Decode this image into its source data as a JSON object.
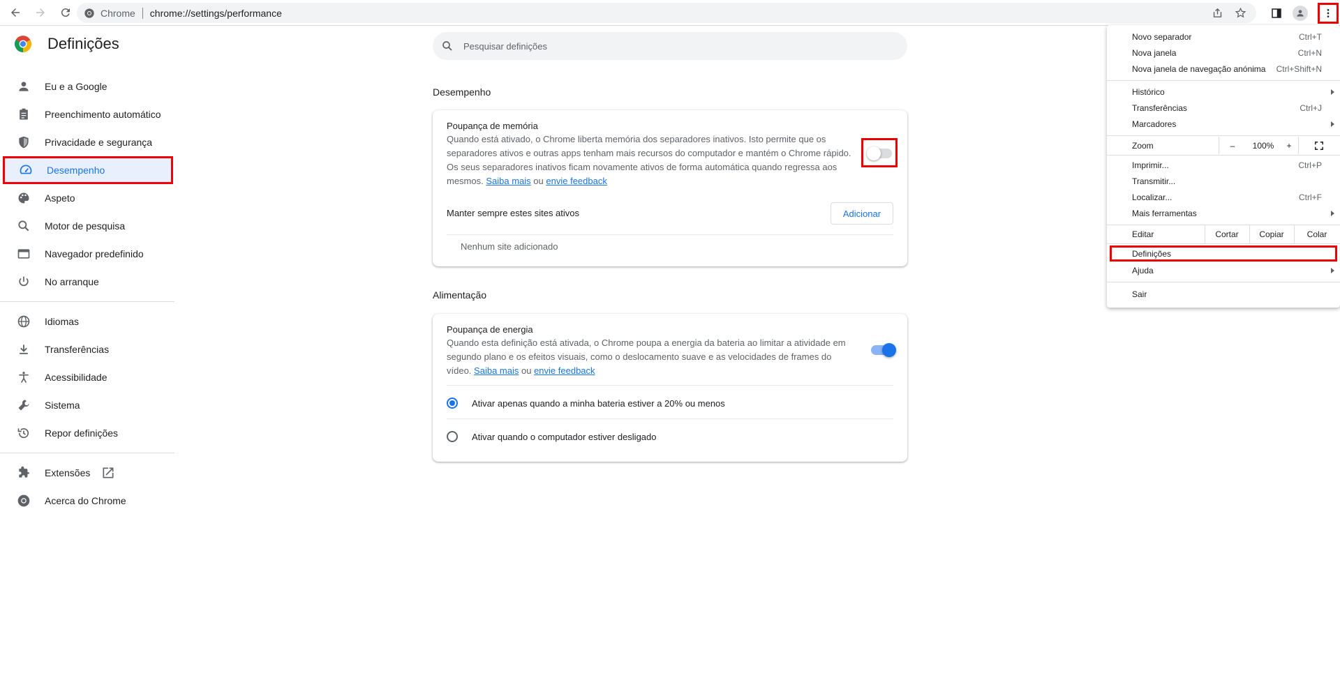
{
  "omnibox": {
    "site_label": "Chrome",
    "url": "chrome://settings/performance"
  },
  "sidebar": {
    "title": "Definições",
    "items": [
      {
        "label": "Eu e a Google",
        "icon": "person-icon"
      },
      {
        "label": "Preenchimento automático",
        "icon": "clipboard-icon"
      },
      {
        "label": "Privacidade e segurança",
        "icon": "shield-icon"
      },
      {
        "label": "Desempenho",
        "icon": "speedometer-icon"
      },
      {
        "label": "Aspeto",
        "icon": "palette-icon"
      },
      {
        "label": "Motor de pesquisa",
        "icon": "search-icon"
      },
      {
        "label": "Navegador predefinido",
        "icon": "browser-icon"
      },
      {
        "label": "No arranque",
        "icon": "power-icon"
      },
      {
        "label": "Idiomas",
        "icon": "globe-icon"
      },
      {
        "label": "Transferências",
        "icon": "download-icon"
      },
      {
        "label": "Acessibilidade",
        "icon": "accessibility-icon"
      },
      {
        "label": "Sistema",
        "icon": "wrench-icon"
      },
      {
        "label": "Repor definições",
        "icon": "restore-icon"
      },
      {
        "label": "Extensões",
        "icon": "puzzle-icon"
      },
      {
        "label": "Acerca do Chrome",
        "icon": "chrome-icon"
      }
    ]
  },
  "search": {
    "placeholder": "Pesquisar definições"
  },
  "performance": {
    "section_title": "Desempenho",
    "memory_saver_title": "Poupança de memória",
    "memory_saver_desc": "Quando está ativado, o Chrome liberta memória dos separadores inativos. Isto permite que os separadores ativos e outras apps tenham mais recursos do computador e mantém o Chrome rápido. Os seus separadores inativos ficam novamente ativos de forma automática quando regressa aos mesmos.",
    "learn_more": "Saiba mais",
    "or": "ou",
    "feedback": "envie feedback",
    "keep_active_label": "Manter sempre estes sites ativos",
    "add_button": "Adicionar",
    "no_sites": "Nenhum site adicionado"
  },
  "power": {
    "section_title": "Alimentação",
    "energy_saver_title": "Poupança de energia",
    "energy_saver_desc": "Quando esta definição está ativada, o Chrome poupa a energia da bateria ao limitar a atividade em segundo plano e os efeitos visuais, como o deslocamento suave e as velocidades de frames do vídeo.",
    "learn_more": "Saiba mais",
    "or": "ou",
    "feedback": "envie feedback",
    "option1": "Ativar apenas quando a minha bateria estiver a 20% ou menos",
    "option2": "Ativar quando o computador estiver desligado"
  },
  "menu": {
    "new_tab": "Novo separador",
    "new_tab_sc": "Ctrl+T",
    "new_window": "Nova janela",
    "new_window_sc": "Ctrl+N",
    "incognito": "Nova janela de navegação anónima",
    "incognito_sc": "Ctrl+Shift+N",
    "history": "Histórico",
    "downloads": "Transferências",
    "downloads_sc": "Ctrl+J",
    "bookmarks": "Marcadores",
    "zoom": "Zoom",
    "zoom_minus": "–",
    "zoom_value": "100%",
    "zoom_plus": "+",
    "print": "Imprimir...",
    "print_sc": "Ctrl+P",
    "cast": "Transmitir...",
    "find": "Localizar...",
    "find_sc": "Ctrl+F",
    "more_tools": "Mais ferramentas",
    "edit": "Editar",
    "cut": "Cortar",
    "copy": "Copiar",
    "paste": "Colar",
    "settings": "Definições",
    "help": "Ajuda",
    "exit": "Sair"
  },
  "colors": {
    "accent": "#1a73e8",
    "highlight": "#ee0000"
  }
}
